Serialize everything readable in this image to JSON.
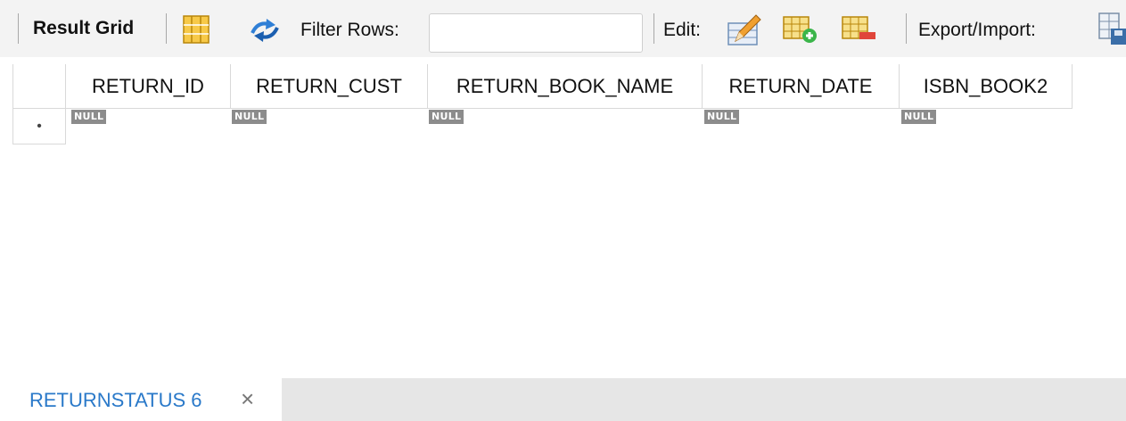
{
  "toolbar": {
    "result_grid_label": "Result Grid",
    "filter_rows_label": "Filter Rows:",
    "filter_value": "",
    "edit_label": "Edit:",
    "export_import_label": "Export/Import:"
  },
  "grid": {
    "columns": [
      "RETURN_ID",
      "RETURN_CUST",
      "RETURN_BOOK_NAME",
      "RETURN_DATE",
      "ISBN_BOOK2"
    ],
    "new_row_marker": "•",
    "null_label": "NULL"
  },
  "tabs": [
    {
      "label": "RETURNSTATUS 6",
      "close": "×"
    }
  ],
  "icons": [
    "grid-layout-icon",
    "refresh-icon",
    "edit-pencil-icon",
    "add-row-icon",
    "delete-row-icon",
    "export-import-icon"
  ],
  "colors": {
    "tab_text": "#2a79c9",
    "null_badge": "#8c8c8c",
    "toolbar_bg": "#f3f3f3"
  }
}
